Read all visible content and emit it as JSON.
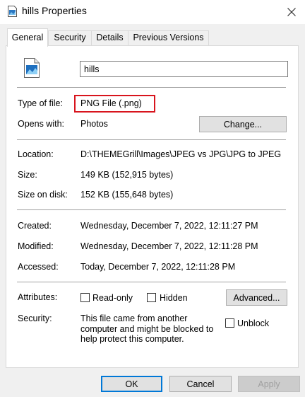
{
  "window": {
    "title": "hills Properties",
    "icon": "image-file-icon"
  },
  "tabs": [
    {
      "label": "General",
      "active": true
    },
    {
      "label": "Security",
      "active": false
    },
    {
      "label": "Details",
      "active": false
    },
    {
      "label": "Previous Versions",
      "active": false
    }
  ],
  "general": {
    "file_name": "hills",
    "type_label": "Type of file:",
    "type_value": "PNG File (.png)",
    "opens_label": "Opens with:",
    "opens_value": "Photos",
    "change_button": "Change...",
    "location_label": "Location:",
    "location_value": "D:\\THEMEGrill\\Images\\JPEG vs JPG\\JPG to JPEG",
    "size_label": "Size:",
    "size_value": "149 KB (152,915 bytes)",
    "disk_label": "Size on disk:",
    "disk_value": "152 KB (155,648 bytes)",
    "created_label": "Created:",
    "created_value": "Wednesday, December 7, 2022, 12:11:27 PM",
    "modified_label": "Modified:",
    "modified_value": "Wednesday, December 7, 2022, 12:11:28 PM",
    "accessed_label": "Accessed:",
    "accessed_value": "Today, December 7, 2022, 12:11:28 PM",
    "attributes_label": "Attributes:",
    "readonly_label": "Read-only",
    "hidden_label": "Hidden",
    "advanced_button": "Advanced...",
    "security_label": "Security:",
    "security_text": "This file came from another computer and might be blocked to help protect this computer.",
    "unblock_label": "Unblock"
  },
  "footer": {
    "ok": "OK",
    "cancel": "Cancel",
    "apply": "Apply"
  },
  "colors": {
    "highlight_border": "#d8141d",
    "focus_border": "#0078d7"
  }
}
